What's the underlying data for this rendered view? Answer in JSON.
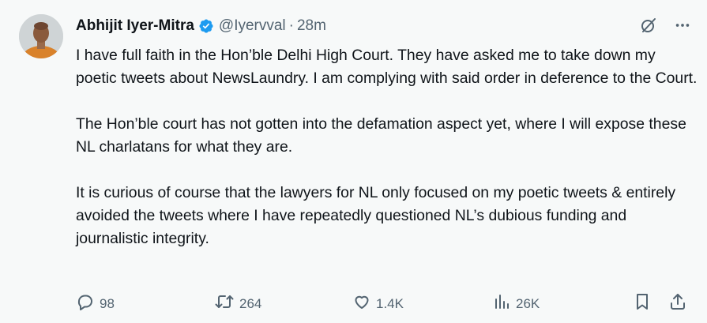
{
  "tweet": {
    "author_name": "Abhijit Iyer-Mitra",
    "handle": "@Iyervval",
    "separator": "·",
    "time": "28m",
    "paragraphs": [
      "I have full faith in the Hon’ble Delhi High Court. They have asked me to take down my poetic tweets about NewsLaundry. I am complying with said order in deference to the Court.",
      "The Hon’ble court has not gotten into the defamation aspect yet, where I will expose these NL charlatans for what they are.",
      "It is curious of course that the lawyers for NL only focused on my poetic tweets & entirely avoided the tweets where I have repeatedly questioned NL’s dubious funding and journalistic integrity."
    ]
  },
  "actions": {
    "replies": "98",
    "reposts": "264",
    "likes": "1.4K",
    "views": "26K"
  },
  "icons": {
    "verified": "verified-badge-icon",
    "grok": "grok-icon",
    "more": "more-icon",
    "reply": "reply-icon",
    "repost": "repost-icon",
    "like": "heart-icon",
    "views": "views-icon",
    "bookmark": "bookmark-icon",
    "share": "share-icon"
  },
  "colors": {
    "background": "#f7f9f9",
    "text": "#0f1419",
    "secondary": "#536471",
    "verified": "#1d9bf0"
  }
}
